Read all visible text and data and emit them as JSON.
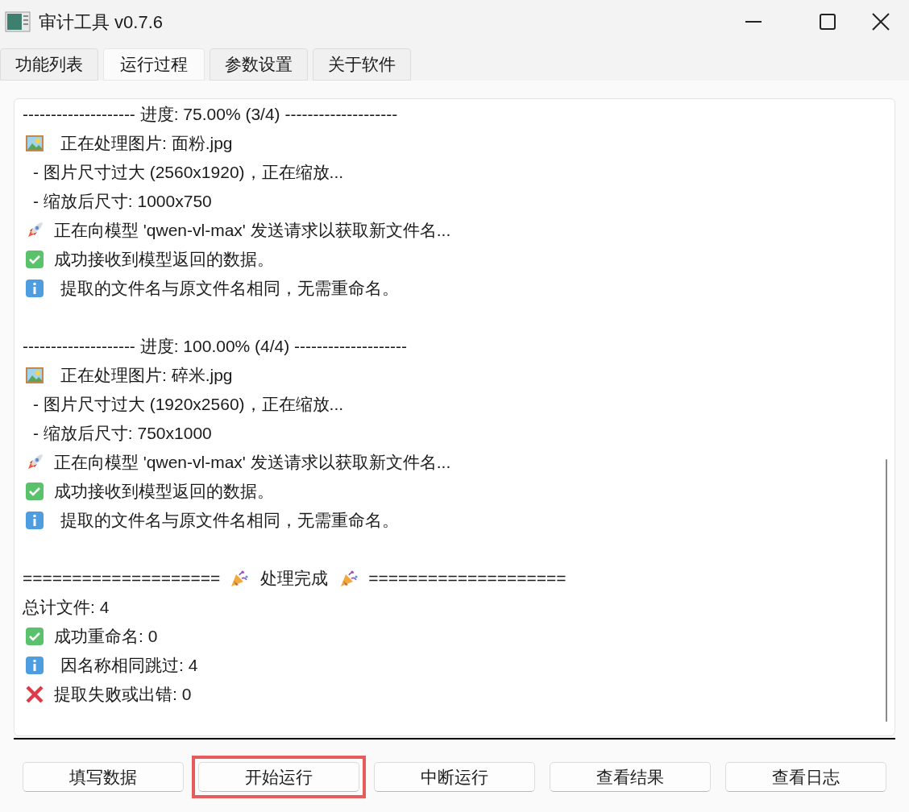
{
  "window": {
    "title": "审计工具 v0.7.6"
  },
  "tabs": [
    {
      "label": "功能列表",
      "selected": false
    },
    {
      "label": "运行过程",
      "selected": true
    },
    {
      "label": "参数设置",
      "selected": false
    },
    {
      "label": "关于软件",
      "selected": false
    }
  ],
  "log": [
    {
      "kind": "header",
      "text": "-------------------- 进度: 75.00% (3/4) --------------------"
    },
    {
      "kind": "picture",
      "text": "正在处理图片: 面粉.jpg"
    },
    {
      "kind": "sub",
      "text": "- 图片尺寸过大 (2560x1920)，正在缩放..."
    },
    {
      "kind": "sub",
      "text": "- 缩放后尺寸: 1000x750"
    },
    {
      "kind": "rocket",
      "text": "正在向模型 'qwen-vl-max' 发送请求以获取新文件名..."
    },
    {
      "kind": "check",
      "text": "成功接收到模型返回的数据。"
    },
    {
      "kind": "info",
      "text": "提取的文件名与原文件名相同，无需重命名。"
    },
    {
      "kind": "blank"
    },
    {
      "kind": "header",
      "text": "-------------------- 进度: 100.00% (4/4) --------------------"
    },
    {
      "kind": "picture",
      "text": "正在处理图片: 碎米.jpg"
    },
    {
      "kind": "sub",
      "text": "- 图片尺寸过大 (1920x2560)，正在缩放..."
    },
    {
      "kind": "sub",
      "text": "- 缩放后尺寸: 750x1000"
    },
    {
      "kind": "rocket",
      "text": "正在向模型 'qwen-vl-max' 发送请求以获取新文件名..."
    },
    {
      "kind": "check",
      "text": "成功接收到模型返回的数据。"
    },
    {
      "kind": "info",
      "text": "提取的文件名与原文件名相同，无需重命名。"
    },
    {
      "kind": "blank"
    },
    {
      "kind": "banner",
      "left": "====================",
      "text": "处理完成",
      "right": "===================="
    },
    {
      "kind": "plain",
      "text": "总计文件: 4"
    },
    {
      "kind": "check",
      "text": "成功重命名: 0"
    },
    {
      "kind": "info",
      "text": "因名称相同跳过: 4"
    },
    {
      "kind": "cross",
      "text": "提取失败或出错: 0"
    }
  ],
  "buttons": [
    {
      "label": "填写数据",
      "highlighted": false
    },
    {
      "label": "开始运行",
      "highlighted": true
    },
    {
      "label": "中断运行",
      "highlighted": false
    },
    {
      "label": "查看结果",
      "highlighted": false
    },
    {
      "label": "查看日志",
      "highlighted": false
    }
  ]
}
